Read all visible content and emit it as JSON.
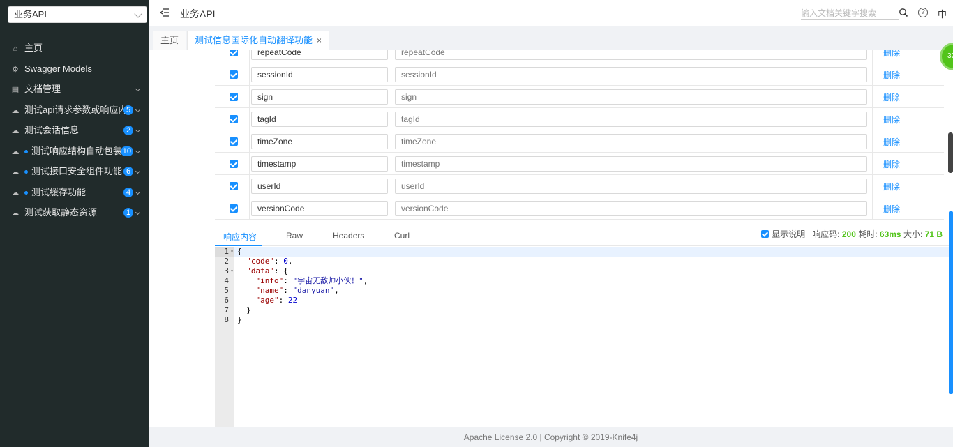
{
  "sidebar": {
    "group_select": "业务API",
    "items": [
      {
        "label": "主页",
        "icon": "home-icon",
        "badge": "",
        "dot": false,
        "chevron": false
      },
      {
        "label": "Swagger Models",
        "icon": "models-icon",
        "badge": "",
        "dot": false,
        "chevron": false
      },
      {
        "label": "文档管理",
        "icon": "doc-icon",
        "badge": "",
        "dot": false,
        "chevron": true
      },
      {
        "label": "测试api请求参数或响应内容",
        "icon": "cloud-icon",
        "badge": "5",
        "dot": false,
        "chevron": true
      },
      {
        "label": "测试会话信息",
        "icon": "cloud-icon",
        "badge": "2",
        "dot": false,
        "chevron": true
      },
      {
        "label": "测试响应结构自动包装相关",
        "icon": "cloud-icon",
        "badge": "10",
        "dot": true,
        "chevron": true
      },
      {
        "label": "测试接口安全组件功能",
        "icon": "cloud-icon",
        "badge": "6",
        "dot": true,
        "chevron": true
      },
      {
        "label": "测试缓存功能",
        "icon": "cloud-icon",
        "badge": "4",
        "dot": true,
        "chevron": true
      },
      {
        "label": "测试获取静态资源",
        "icon": "cloud-icon",
        "badge": "1",
        "dot": false,
        "chevron": true
      }
    ]
  },
  "header": {
    "title": "业务API",
    "search_placeholder": "输入文档关键字搜索",
    "help": "?",
    "lang": "中"
  },
  "tabs": {
    "home": "主页",
    "active": "测试信息国际化自动翻译功能",
    "close": "×"
  },
  "params": {
    "delete_label": "删除",
    "rows": [
      {
        "name": "repeatCode",
        "desc": "repeatCode"
      },
      {
        "name": "sessionId",
        "desc": "sessionId"
      },
      {
        "name": "sign",
        "desc": "sign"
      },
      {
        "name": "tagId",
        "desc": "tagId"
      },
      {
        "name": "timeZone",
        "desc": "timeZone"
      },
      {
        "name": "timestamp",
        "desc": "timestamp"
      },
      {
        "name": "userId",
        "desc": "userId"
      },
      {
        "name": "versionCode",
        "desc": "versionCode"
      }
    ]
  },
  "response": {
    "tabs": [
      "响应内容",
      "Raw",
      "Headers",
      "Curl"
    ],
    "show_desc": "显示说明",
    "code_label": "响应码:",
    "code_value": "200",
    "time_label": "耗时:",
    "time_value": "63ms",
    "size_label": "大小:",
    "size_value": "71 B",
    "code_lines": [
      "1",
      "2",
      "3",
      "4",
      "5",
      "6",
      "7",
      "8"
    ]
  },
  "float_ball": "32",
  "footer": "Apache License 2.0 | Copyright © 2019-Knife4j"
}
